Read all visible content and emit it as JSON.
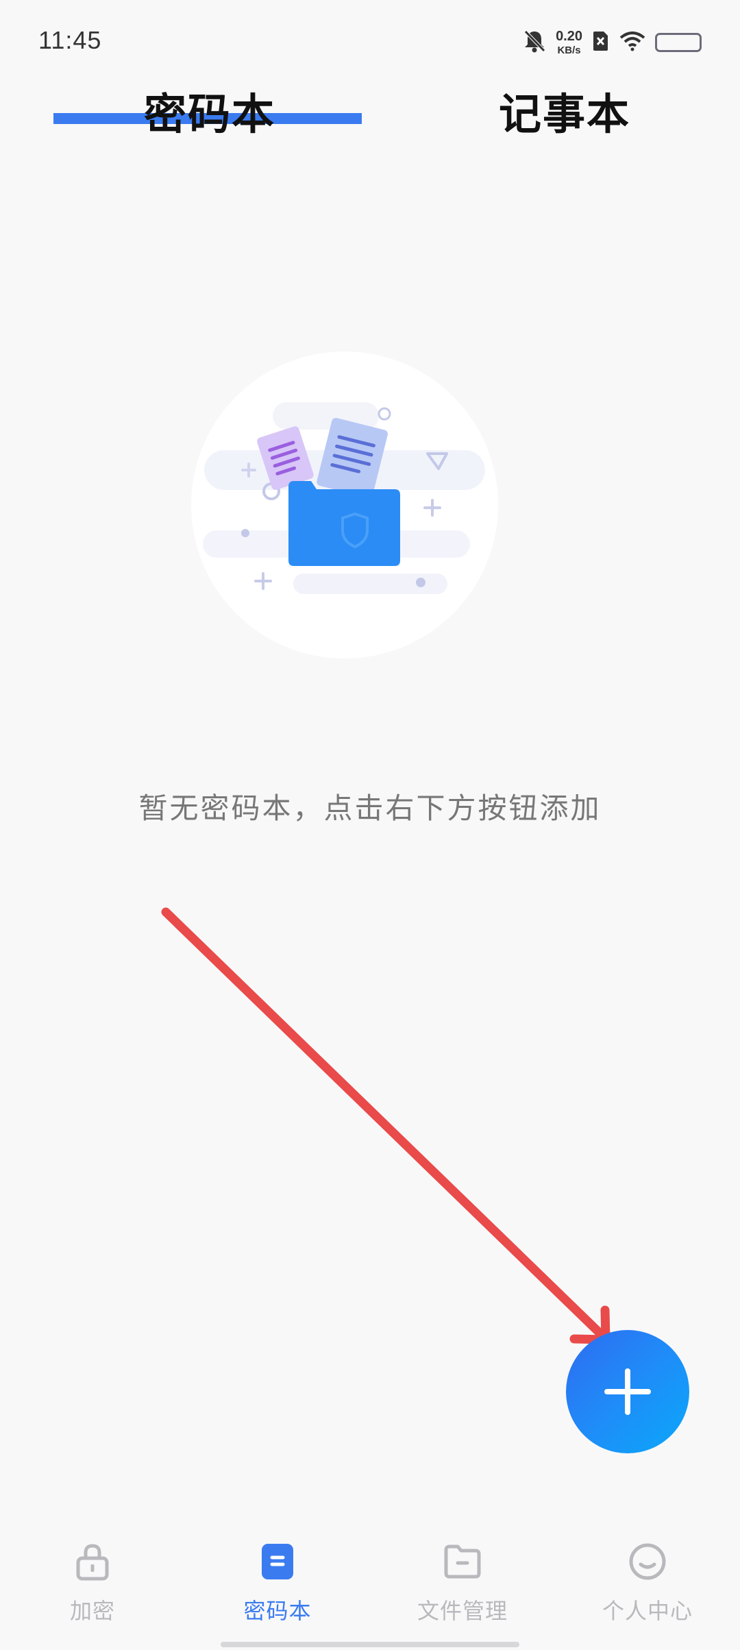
{
  "status_bar": {
    "time": "11:45",
    "net_speed_value": "0.20",
    "net_speed_unit": "KB/s",
    "icons": [
      "bell-muted-icon",
      "sim-off-icon",
      "wifi-icon",
      "battery-icon"
    ]
  },
  "tabs": [
    {
      "label": "密码本",
      "active": true
    },
    {
      "label": "记事本",
      "active": false
    }
  ],
  "empty_state": {
    "message": "暂无密码本，点击右下方按钮添加",
    "illustration": "empty-folder-illustration"
  },
  "fab": {
    "icon": "plus-icon"
  },
  "annotation": {
    "icon": "red-arrow-annotation"
  },
  "bottom_nav": [
    {
      "label": "加密",
      "icon": "lock-icon",
      "active": false
    },
    {
      "label": "密码本",
      "icon": "notebook-icon",
      "active": true
    },
    {
      "label": "文件管理",
      "icon": "folder-icon",
      "active": false
    },
    {
      "label": "个人中心",
      "icon": "smile-icon",
      "active": false
    }
  ],
  "colors": {
    "accent": "#3a7bf0",
    "background": "#f8f8f9",
    "annotation_arrow": "#e94a4a",
    "inactive": "#b9b9bd"
  }
}
